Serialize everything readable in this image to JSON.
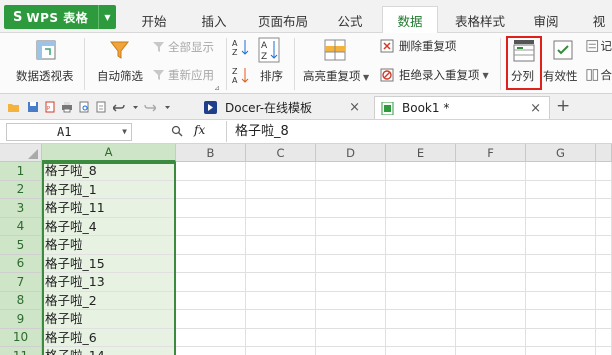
{
  "app": {
    "logo": "S",
    "name": "WPS 表格"
  },
  "tabs": [
    {
      "label": "开始"
    },
    {
      "label": "插入"
    },
    {
      "label": "页面布局"
    },
    {
      "label": "公式"
    },
    {
      "label": "数据",
      "active": true
    },
    {
      "label": "表格样式"
    },
    {
      "label": "审阅"
    },
    {
      "label": "视"
    }
  ],
  "ribbon": {
    "pivot_label": "数据透视表",
    "autofilter_label": "自动筛选",
    "show_all_label": "全部显示",
    "reapply_label": "重新应用",
    "sort_label": "排序",
    "highlight_dup_label": "高亮重复项",
    "remove_dup_label": "删除重复项",
    "reject_dup_label": "拒绝录入重复项",
    "split_label": "分列",
    "validity_label": "有效性",
    "partial_1": "记",
    "partial_2": "合"
  },
  "doc_tabs": [
    {
      "label": "Docer-在线模板",
      "close": "×"
    },
    {
      "label": "Book1 *",
      "close": "×"
    }
  ],
  "new_tab": "+",
  "formula_bar": {
    "cell_ref": "A1",
    "fx": "fx",
    "content": "格子啦_8"
  },
  "columns": [
    "A",
    "B",
    "C",
    "D",
    "E",
    "F",
    "G"
  ],
  "rows": [
    {
      "num": "1",
      "a": "格子啦_8"
    },
    {
      "num": "2",
      "a": "格子啦_1"
    },
    {
      "num": "3",
      "a": "格子啦_11"
    },
    {
      "num": "4",
      "a": "格子啦_4"
    },
    {
      "num": "5",
      "a": "格子啦"
    },
    {
      "num": "6",
      "a": "格子啦_15"
    },
    {
      "num": "7",
      "a": "格子啦_13"
    },
    {
      "num": "8",
      "a": "格子啦_2"
    },
    {
      "num": "9",
      "a": "格子啦"
    },
    {
      "num": "10",
      "a": "格子啦_6"
    },
    {
      "num": "11",
      "a": "格子啦_14"
    }
  ],
  "colors": {
    "brand": "#2e9a3e",
    "selection": "#3c8a3f",
    "highlight_box": "#e0201b"
  }
}
